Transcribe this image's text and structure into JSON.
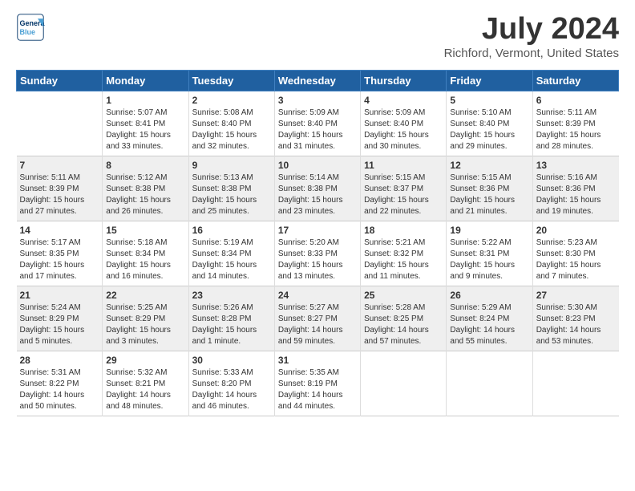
{
  "header": {
    "logo_line1": "General",
    "logo_line2": "Blue",
    "month": "July 2024",
    "location": "Richford, Vermont, United States"
  },
  "days_of_week": [
    "Sunday",
    "Monday",
    "Tuesday",
    "Wednesday",
    "Thursday",
    "Friday",
    "Saturday"
  ],
  "weeks": [
    [
      {
        "num": "",
        "info": ""
      },
      {
        "num": "1",
        "info": "Sunrise: 5:07 AM\nSunset: 8:41 PM\nDaylight: 15 hours\nand 33 minutes."
      },
      {
        "num": "2",
        "info": "Sunrise: 5:08 AM\nSunset: 8:40 PM\nDaylight: 15 hours\nand 32 minutes."
      },
      {
        "num": "3",
        "info": "Sunrise: 5:09 AM\nSunset: 8:40 PM\nDaylight: 15 hours\nand 31 minutes."
      },
      {
        "num": "4",
        "info": "Sunrise: 5:09 AM\nSunset: 8:40 PM\nDaylight: 15 hours\nand 30 minutes."
      },
      {
        "num": "5",
        "info": "Sunrise: 5:10 AM\nSunset: 8:40 PM\nDaylight: 15 hours\nand 29 minutes."
      },
      {
        "num": "6",
        "info": "Sunrise: 5:11 AM\nSunset: 8:39 PM\nDaylight: 15 hours\nand 28 minutes."
      }
    ],
    [
      {
        "num": "7",
        "info": "Sunrise: 5:11 AM\nSunset: 8:39 PM\nDaylight: 15 hours\nand 27 minutes."
      },
      {
        "num": "8",
        "info": "Sunrise: 5:12 AM\nSunset: 8:38 PM\nDaylight: 15 hours\nand 26 minutes."
      },
      {
        "num": "9",
        "info": "Sunrise: 5:13 AM\nSunset: 8:38 PM\nDaylight: 15 hours\nand 25 minutes."
      },
      {
        "num": "10",
        "info": "Sunrise: 5:14 AM\nSunset: 8:38 PM\nDaylight: 15 hours\nand 23 minutes."
      },
      {
        "num": "11",
        "info": "Sunrise: 5:15 AM\nSunset: 8:37 PM\nDaylight: 15 hours\nand 22 minutes."
      },
      {
        "num": "12",
        "info": "Sunrise: 5:15 AM\nSunset: 8:36 PM\nDaylight: 15 hours\nand 21 minutes."
      },
      {
        "num": "13",
        "info": "Sunrise: 5:16 AM\nSunset: 8:36 PM\nDaylight: 15 hours\nand 19 minutes."
      }
    ],
    [
      {
        "num": "14",
        "info": "Sunrise: 5:17 AM\nSunset: 8:35 PM\nDaylight: 15 hours\nand 17 minutes."
      },
      {
        "num": "15",
        "info": "Sunrise: 5:18 AM\nSunset: 8:34 PM\nDaylight: 15 hours\nand 16 minutes."
      },
      {
        "num": "16",
        "info": "Sunrise: 5:19 AM\nSunset: 8:34 PM\nDaylight: 15 hours\nand 14 minutes."
      },
      {
        "num": "17",
        "info": "Sunrise: 5:20 AM\nSunset: 8:33 PM\nDaylight: 15 hours\nand 13 minutes."
      },
      {
        "num": "18",
        "info": "Sunrise: 5:21 AM\nSunset: 8:32 PM\nDaylight: 15 hours\nand 11 minutes."
      },
      {
        "num": "19",
        "info": "Sunrise: 5:22 AM\nSunset: 8:31 PM\nDaylight: 15 hours\nand 9 minutes."
      },
      {
        "num": "20",
        "info": "Sunrise: 5:23 AM\nSunset: 8:30 PM\nDaylight: 15 hours\nand 7 minutes."
      }
    ],
    [
      {
        "num": "21",
        "info": "Sunrise: 5:24 AM\nSunset: 8:29 PM\nDaylight: 15 hours\nand 5 minutes."
      },
      {
        "num": "22",
        "info": "Sunrise: 5:25 AM\nSunset: 8:29 PM\nDaylight: 15 hours\nand 3 minutes."
      },
      {
        "num": "23",
        "info": "Sunrise: 5:26 AM\nSunset: 8:28 PM\nDaylight: 15 hours\nand 1 minute."
      },
      {
        "num": "24",
        "info": "Sunrise: 5:27 AM\nSunset: 8:27 PM\nDaylight: 14 hours\nand 59 minutes."
      },
      {
        "num": "25",
        "info": "Sunrise: 5:28 AM\nSunset: 8:25 PM\nDaylight: 14 hours\nand 57 minutes."
      },
      {
        "num": "26",
        "info": "Sunrise: 5:29 AM\nSunset: 8:24 PM\nDaylight: 14 hours\nand 55 minutes."
      },
      {
        "num": "27",
        "info": "Sunrise: 5:30 AM\nSunset: 8:23 PM\nDaylight: 14 hours\nand 53 minutes."
      }
    ],
    [
      {
        "num": "28",
        "info": "Sunrise: 5:31 AM\nSunset: 8:22 PM\nDaylight: 14 hours\nand 50 minutes."
      },
      {
        "num": "29",
        "info": "Sunrise: 5:32 AM\nSunset: 8:21 PM\nDaylight: 14 hours\nand 48 minutes."
      },
      {
        "num": "30",
        "info": "Sunrise: 5:33 AM\nSunset: 8:20 PM\nDaylight: 14 hours\nand 46 minutes."
      },
      {
        "num": "31",
        "info": "Sunrise: 5:35 AM\nSunset: 8:19 PM\nDaylight: 14 hours\nand 44 minutes."
      },
      {
        "num": "",
        "info": ""
      },
      {
        "num": "",
        "info": ""
      },
      {
        "num": "",
        "info": ""
      }
    ]
  ]
}
